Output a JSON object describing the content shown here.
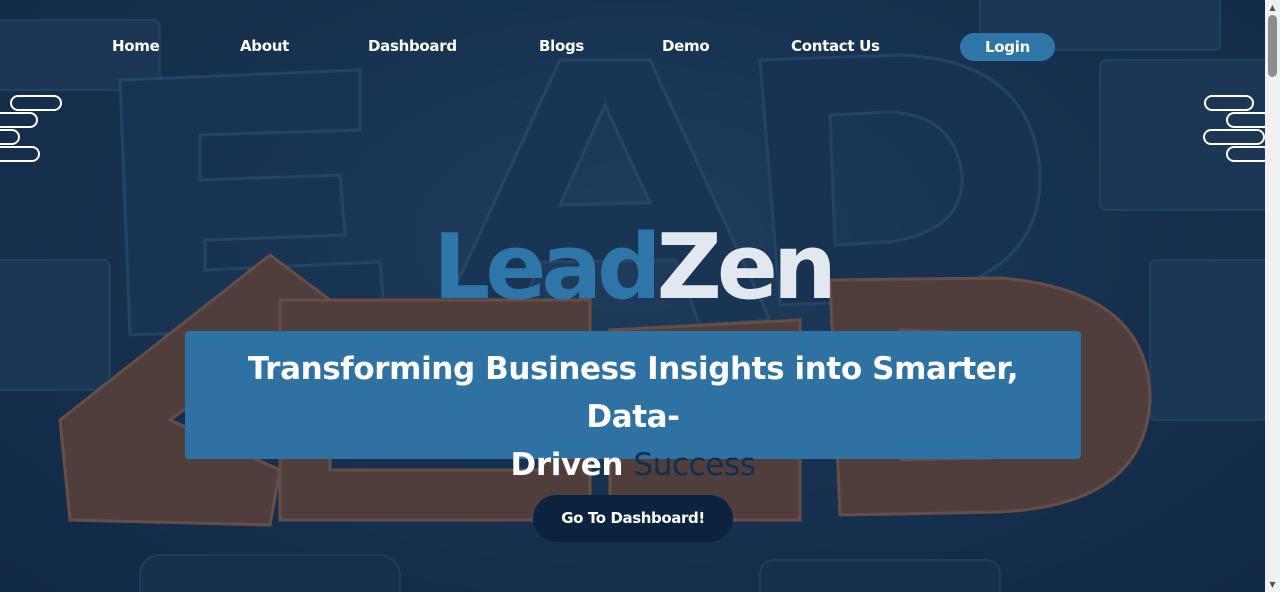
{
  "nav": {
    "links": [
      {
        "label": "Home"
      },
      {
        "label": "About"
      },
      {
        "label": "Dashboard"
      },
      {
        "label": "Blogs"
      },
      {
        "label": "Demo"
      },
      {
        "label": "Contact Us"
      }
    ],
    "login_label": "Login"
  },
  "hero": {
    "brand_part1": "Lead",
    "brand_part2": "Zen",
    "tagline_line1": "Transforming Business Insights into Smarter, Data-",
    "tagline_line2_plain": "Driven",
    "tagline_line2_accent": "Success",
    "cta_label": "Go To Dashboard!"
  },
  "colors": {
    "accent_blue": "#2f76a8",
    "dark_navy": "#0c2340",
    "brand_light": "#e1e8ef",
    "background": "#1c3a5a"
  },
  "icons": {
    "decor_left": "pill-stack-decoration",
    "decor_right": "pill-stack-decoration",
    "scroll_up": "chevron-up-icon",
    "scroll_down": "chevron-down-icon"
  }
}
